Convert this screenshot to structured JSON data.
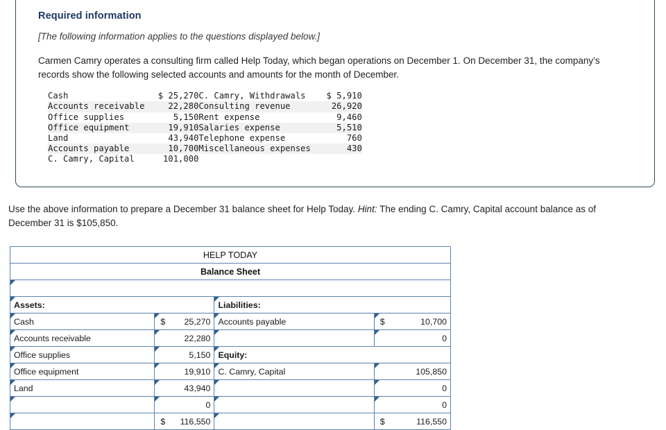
{
  "info_box": {
    "title": "Required information",
    "subtitle": "[The following information applies to the questions displayed below.]",
    "paragraph": "Carmen Camry operates a consulting firm called Help Today, which began operations on December 1. On December 31, the company’s records show the following selected accounts and amounts for the month of December."
  },
  "accounts": {
    "left": [
      {
        "name": "Cash",
        "amount": "$ 25,270"
      },
      {
        "name": "Accounts receivable",
        "amount": "22,280"
      },
      {
        "name": "Office supplies",
        "amount": "5,150"
      },
      {
        "name": "Office equipment",
        "amount": "19,910"
      },
      {
        "name": "Land",
        "amount": "43,940"
      },
      {
        "name": "Accounts payable",
        "amount": "10,700"
      },
      {
        "name": "C. Camry, Capital",
        "amount": "101,000"
      }
    ],
    "right": [
      {
        "name": "C. Camry, Withdrawals",
        "amount": "$ 5,910"
      },
      {
        "name": "Consulting revenue",
        "amount": "26,920"
      },
      {
        "name": "Rent expense",
        "amount": "9,460"
      },
      {
        "name": "Salaries expense",
        "amount": "5,510"
      },
      {
        "name": "Telephone expense",
        "amount": "760"
      },
      {
        "name": "Miscellaneous expenses",
        "amount": "430"
      },
      {
        "name": "",
        "amount": ""
      }
    ]
  },
  "instruction": {
    "part1": "Use the above information to prepare a December 31 balance sheet for Help Today. ",
    "hint_label": "Hint:",
    "part2": " The ending C. Camry, Capital account balance as of December 31 is $105,850."
  },
  "balance_sheet": {
    "company": "HELP TODAY",
    "statement": "Balance Sheet",
    "date_row": "",
    "assets_header": "Assets:",
    "liabilities_header": "Liabilities:",
    "equity_header": "Equity:",
    "assets_rows": [
      {
        "label": "Cash",
        "dollar": "$",
        "amount": "25,270"
      },
      {
        "label": "Accounts receivable",
        "dollar": "",
        "amount": "22,280"
      },
      {
        "label": "Office supplies",
        "dollar": "",
        "amount": "5,150"
      },
      {
        "label": "Office equipment",
        "dollar": "",
        "amount": "19,910"
      },
      {
        "label": "Land",
        "dollar": "",
        "amount": "43,940"
      },
      {
        "label": "",
        "dollar": "",
        "amount": "0"
      }
    ],
    "assets_total": {
      "label": "",
      "dollar": "$",
      "amount": "116,550"
    },
    "liability_rows": [
      {
        "label": "Accounts payable",
        "dollar": "$",
        "amount": "10,700"
      },
      {
        "label": "",
        "dollar": "",
        "amount": "0"
      }
    ],
    "equity_rows": [
      {
        "label": "C. Camry, Capital",
        "dollar": "",
        "amount": "105,850"
      },
      {
        "label": "",
        "dollar": "",
        "amount": "0"
      },
      {
        "label": "",
        "dollar": "",
        "amount": "0"
      }
    ],
    "liab_equity_total": {
      "label": "",
      "dollar": "$",
      "amount": "116,550"
    }
  },
  "colors": {
    "header_blue": "#7fa9de",
    "date_band": "#bcc6da",
    "grid_blue": "#5b83b1",
    "box_border": "#2e4a57",
    "title_navy": "#1f3864"
  }
}
